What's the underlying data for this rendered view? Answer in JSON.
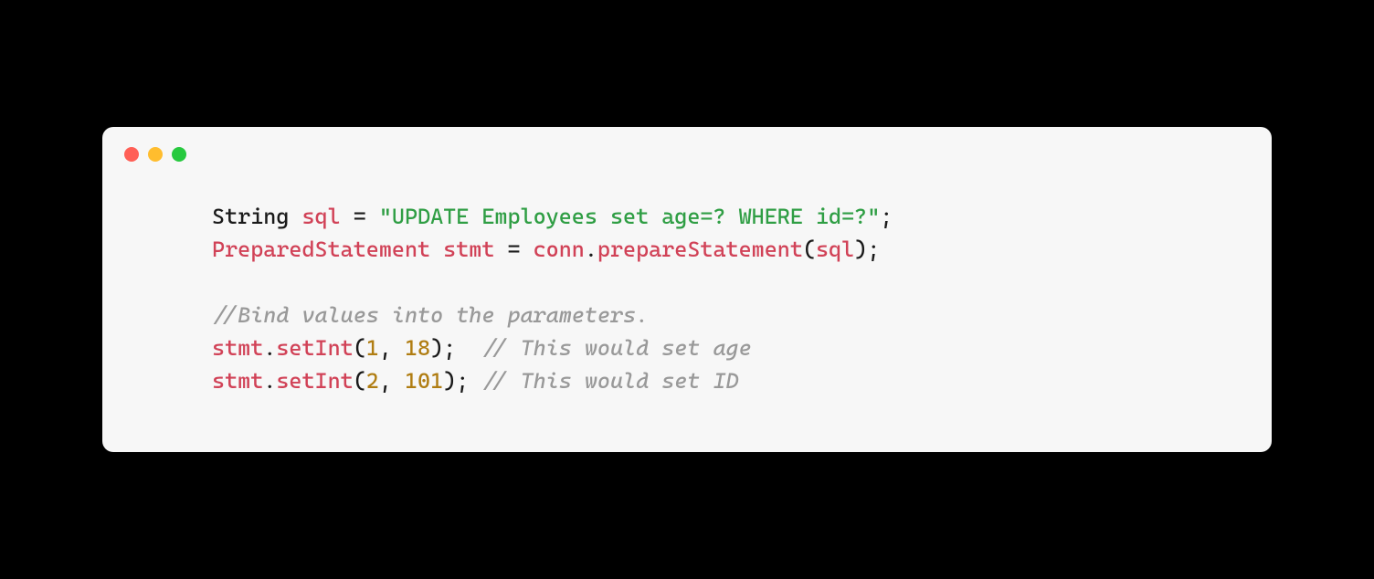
{
  "code": {
    "line1": {
      "type": "String",
      "var": "sql",
      "eq": " = ",
      "str": "\"UPDATE Employees set age=? WHERE id=?\"",
      "semi": ";"
    },
    "line2": {
      "class": "PreparedStatement",
      "sp1": " ",
      "var": "stmt",
      "eq": " = ",
      "obj": "conn",
      "dot": ".",
      "method": "prepareStatement",
      "lp": "(",
      "arg": "sql",
      "rp": ")",
      "semi": ";"
    },
    "line4": {
      "comment": "//Bind values into the parameters."
    },
    "line5": {
      "obj": "stmt",
      "dot": ".",
      "method": "setInt",
      "lp": "(",
      "n1": "1",
      "comma": ", ",
      "n2": "18",
      "rp": ")",
      "semi": ";",
      "pad": "  ",
      "comment": "// This would set age"
    },
    "line6": {
      "obj": "stmt",
      "dot": ".",
      "method": "setInt",
      "lp": "(",
      "n1": "2",
      "comma": ", ",
      "n2": "101",
      "rp": ")",
      "semi": ";",
      "pad": " ",
      "comment": "// This would set ID"
    }
  },
  "colors": {
    "background": "#000000",
    "window_bg": "#f7f7f7",
    "red": "#ff5f56",
    "yellow": "#ffbd2e",
    "green": "#27c93f",
    "variable": "#d14257",
    "string": "#2f9e44",
    "number": "#b07d12",
    "comment": "#999999",
    "default": "#1a1a1a"
  }
}
